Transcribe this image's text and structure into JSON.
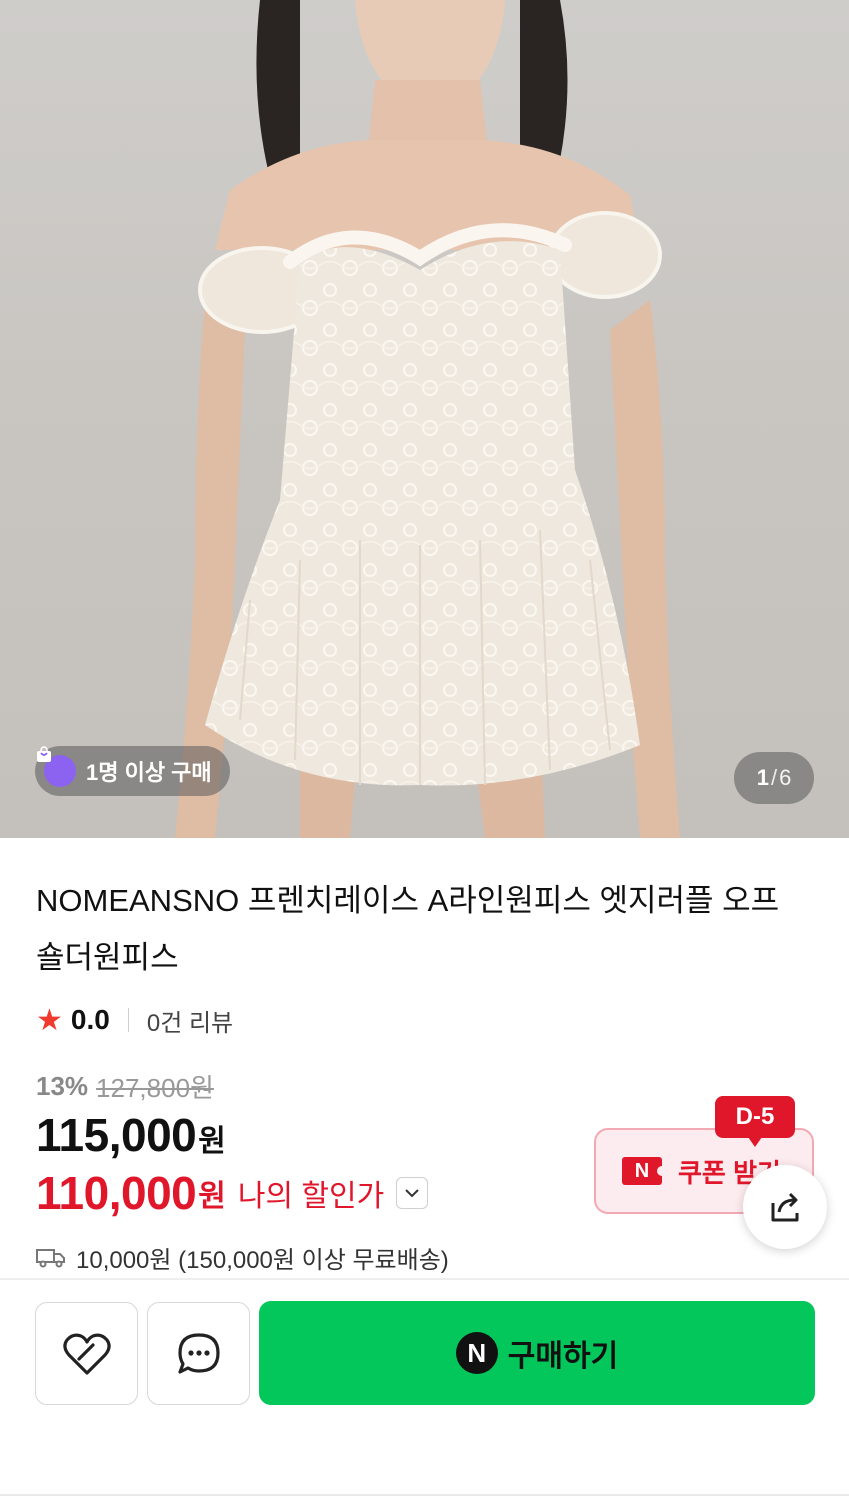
{
  "hero": {
    "buyers_badge": "1명 이상 구매",
    "bag_icon": "shopping-bag-icon",
    "counter_current": "1",
    "counter_separator": "/",
    "counter_total": "6"
  },
  "product": {
    "title": "NOMEANSNO 프렌치레이스 A라인원피스 엣지러플 오프숄더원피스",
    "rating": "0.0",
    "review_count": "0건 리뷰",
    "discount_pct": "13%",
    "original_price": "127,800원",
    "price": "115,000",
    "price_unit": "원",
    "my_price": "110,000",
    "my_price_unit": "원",
    "my_price_label": "나의 할인가"
  },
  "coupon": {
    "dday": "D-5",
    "logo": "N",
    "label": "쿠폰 받기"
  },
  "shipping": {
    "text": "10,000원 (150,000원 이상 무료배송)"
  },
  "actions": {
    "buy_label": "구매하기",
    "buy_logo": "N"
  },
  "colors": {
    "accent_red": "#e0162b",
    "naver_green": "#03c75a",
    "star": "#f03a2e",
    "badge_purple": "#8c63f0"
  }
}
